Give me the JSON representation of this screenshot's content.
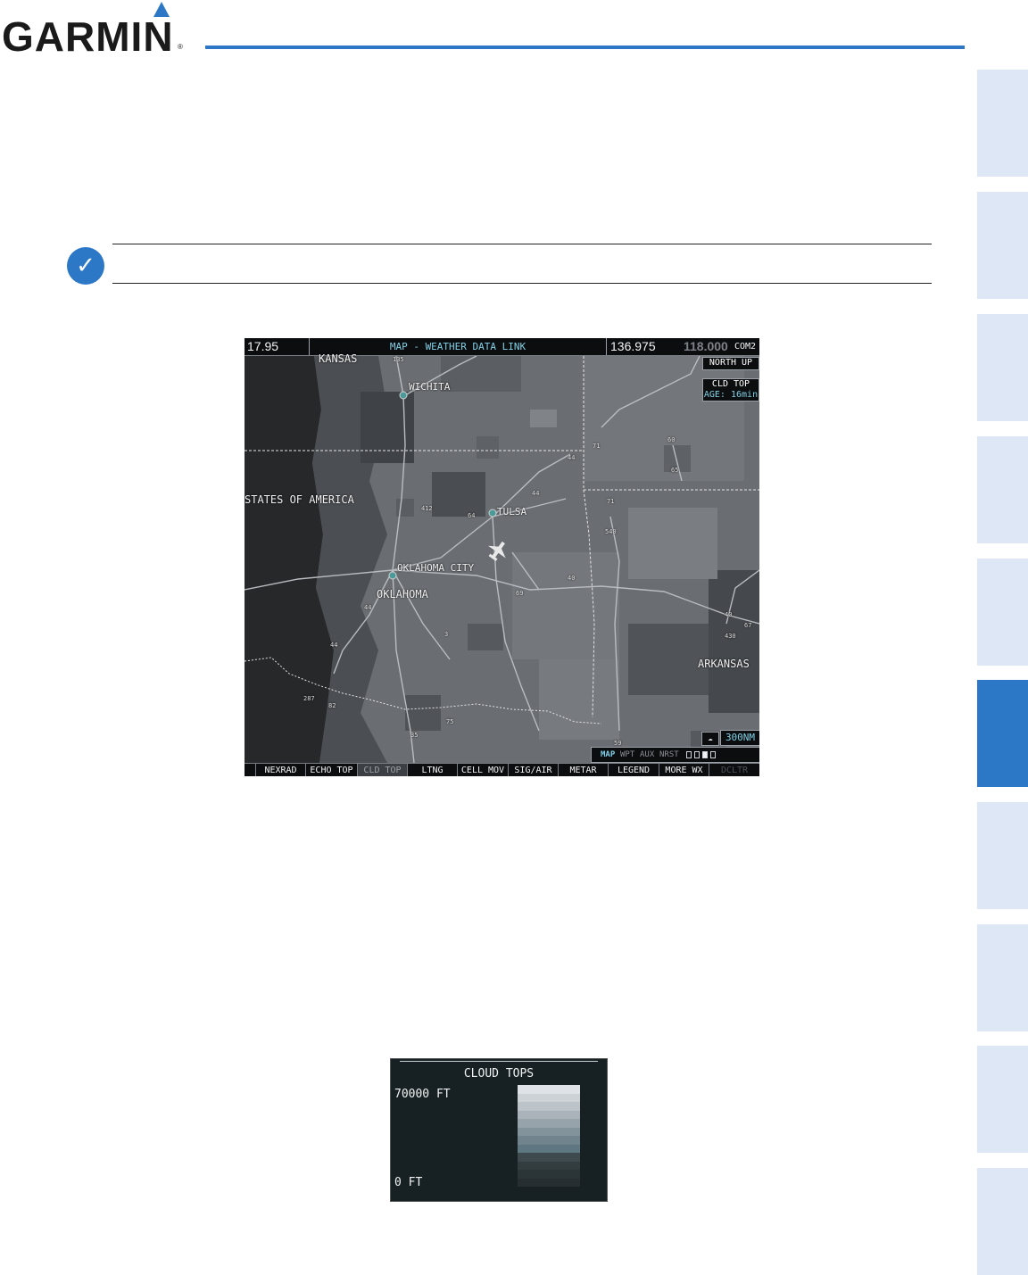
{
  "header": {
    "brand": "GARMIN",
    "reg": "®"
  },
  "note": {
    "icon": "checkmark-icon"
  },
  "mfd": {
    "com1_active": "17.95",
    "page_title": "MAP - WEATHER DATA LINK",
    "com2_active": "136.975",
    "com2_standby": "118.000",
    "com_label": "COM2",
    "orientation": "NORTH UP",
    "product": "CLD TOP",
    "age_label": "AGE:",
    "age_value": "16min",
    "range": "300NM",
    "page_group": {
      "active": "MAP",
      "others": [
        "WPT",
        "AUX",
        "NRST"
      ]
    },
    "softkeys": [
      "",
      "NEXRAD",
      "ECHO TOP",
      "CLD TOP",
      "LTNG",
      "CELL MOV",
      "SIG/AIR",
      "METAR",
      "LEGEND",
      "MORE WX",
      "DCLTR"
    ],
    "selected_softkey": "CLD TOP",
    "map_labels": {
      "kansas": "KANSAS",
      "wichita": "WICHITA",
      "usa": "STATES OF AMERICA",
      "tulsa": "TULSA",
      "okc": "OKLAHOMA CITY",
      "oklahoma": "OKLAHOMA",
      "arkansas": "ARKANSAS"
    },
    "highway_shields": {
      "i135": "135",
      "i44a": "44",
      "i44b": "44",
      "i44c": "44",
      "i44d": "44",
      "i40": "40",
      "i35": "35",
      "i540": "540",
      "i40b": "40",
      "i430": "430",
      "us412": "412",
      "us64": "64",
      "us71a": "71",
      "us71b": "71",
      "us69": "69",
      "us65": "65",
      "us60": "60",
      "us287": "287",
      "us82": "82",
      "us75": "75",
      "us59": "59",
      "us67": "67",
      "us3": "3"
    }
  },
  "legend": {
    "title": "CLOUD TOPS",
    "top_label": "70000 FT",
    "bottom_label": "0 FT",
    "colors": [
      "#dfe2e6",
      "#cdd2d7",
      "#bcc3c9",
      "#aab3ba",
      "#97a3ab",
      "#83939c",
      "#70848e",
      "#5e7781",
      "#3e4a4e",
      "#333c3f",
      "#2b3437",
      "#262e31"
    ]
  },
  "colors": {
    "garmin_blue": "#2c78c7",
    "tab_light": "#dde7f6",
    "cyan_text": "#7fd0e6"
  }
}
